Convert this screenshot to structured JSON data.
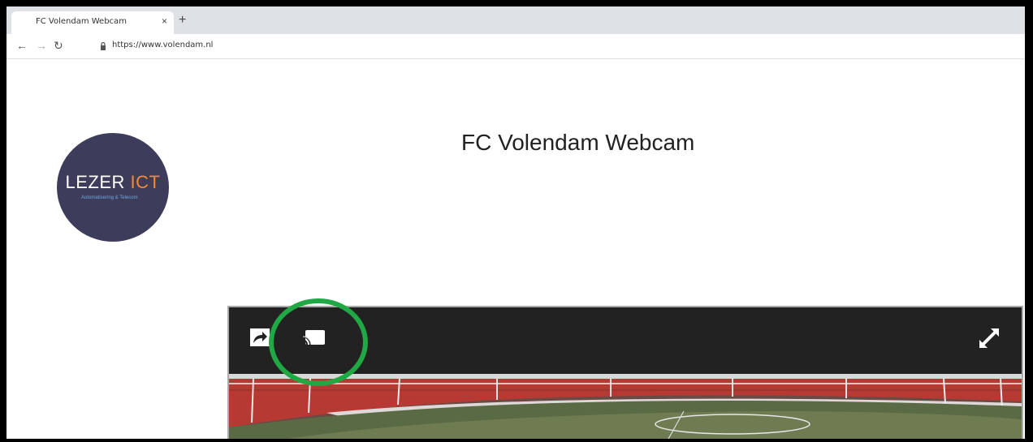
{
  "browser": {
    "tab_title": "FC Volendam Webcam",
    "tab_close": "×",
    "new_tab": "+",
    "url": "https://www.volendam.nl"
  },
  "logo": {
    "main_white": "LEZER ",
    "main_accent": "ICT",
    "subtitle": "Automatisering & Telecom",
    "bg_color": "#3e3c5b",
    "accent_color": "#f08a34"
  },
  "page": {
    "title": "FC Volendam Webcam"
  },
  "player": {
    "controls": [
      "share-icon",
      "cast-icon",
      "fullscreen-icon"
    ],
    "highlight_color": "#1fa843"
  }
}
